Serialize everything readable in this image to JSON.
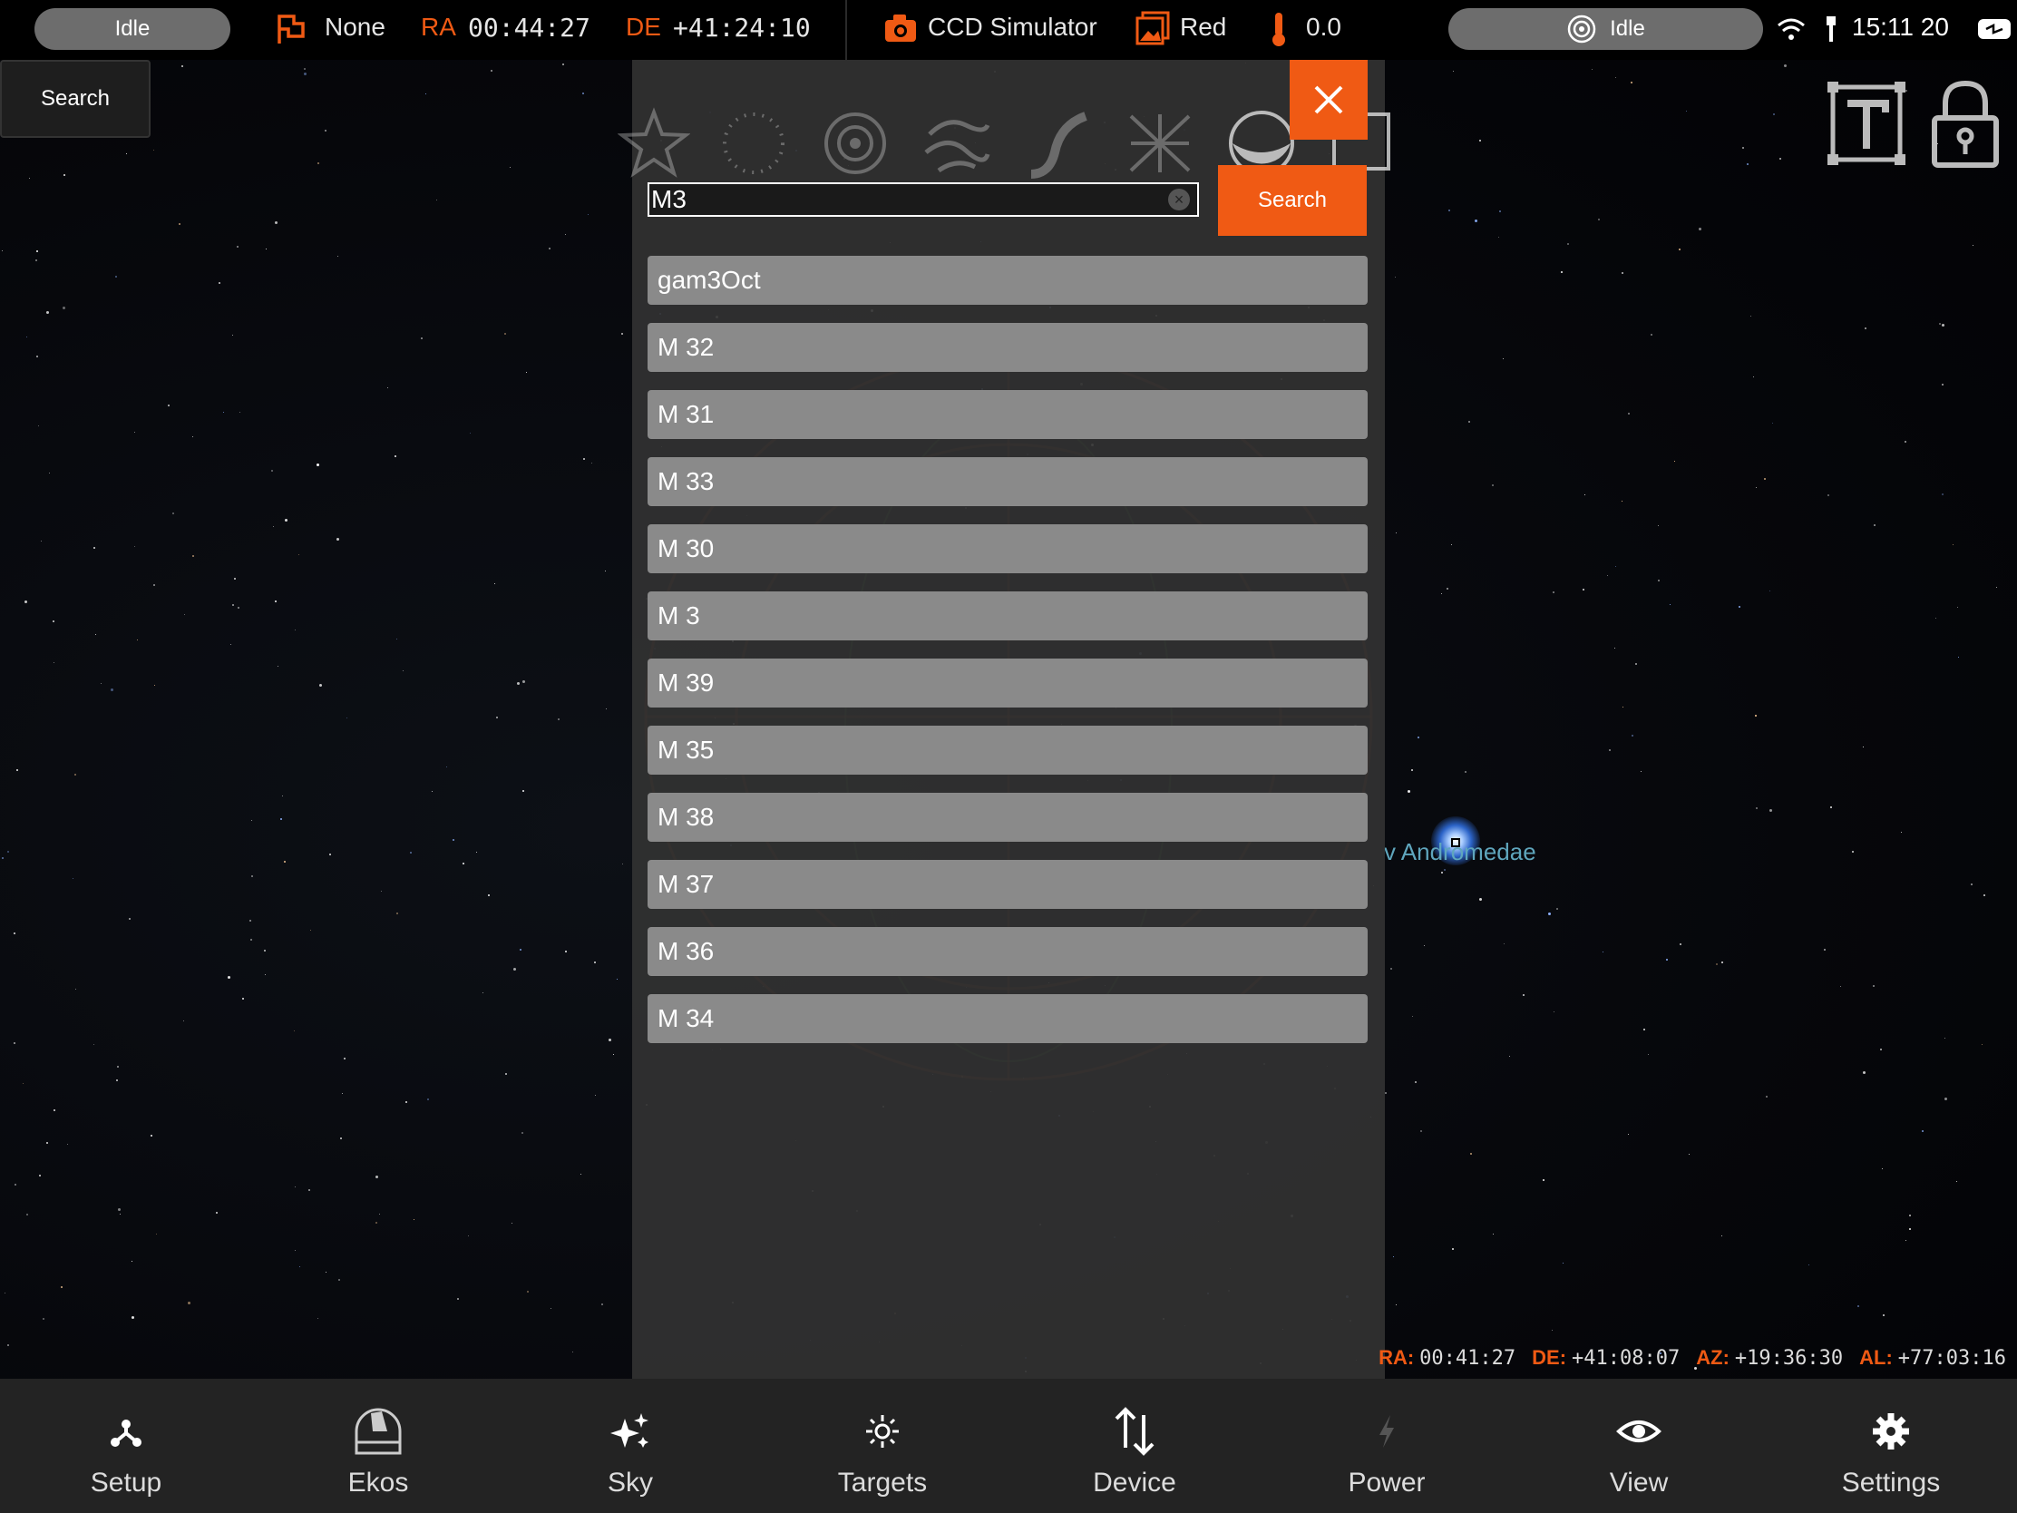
{
  "topbar": {
    "status_left": "Idle",
    "mount_status": "None",
    "ra_label": "RA",
    "ra_value": "00:44:27",
    "de_label": "DE",
    "de_value": "+41:24:10",
    "camera_name": "CCD Simulator",
    "filter_name": "Red",
    "temperature": "0.0",
    "status_right": "Idle",
    "time": "15:11 20"
  },
  "left_panel": {
    "search_label": "Search"
  },
  "dialog": {
    "search_value": "M3",
    "search_button": "Search",
    "results": [
      "gam3Oct",
      "M 32",
      "M 31",
      "M 33",
      "M 30",
      "M 3",
      "M 39",
      "M 35",
      "M 38",
      "M 37",
      "M 36",
      "M 34"
    ]
  },
  "sky": {
    "star_label": "v Andromedae"
  },
  "coords": {
    "ra_label": "RA:",
    "ra_value": "00:41:27",
    "de_label": "DE:",
    "de_value": "+41:08:07",
    "az_label": "AZ:",
    "az_value": "+19:36:30",
    "al_label": "AL:",
    "al_value": "+77:03:16"
  },
  "nav": {
    "items": [
      {
        "label": "Setup",
        "icon": "setup-icon"
      },
      {
        "label": "Ekos",
        "icon": "observatory-dome-icon"
      },
      {
        "label": "Sky",
        "icon": "sparkles-icon"
      },
      {
        "label": "Targets",
        "icon": "target-icon"
      },
      {
        "label": "Device",
        "icon": "arrows-updown-icon"
      },
      {
        "label": "Power",
        "icon": "lightning-icon"
      },
      {
        "label": "View",
        "icon": "eye-icon"
      },
      {
        "label": "Settings",
        "icon": "gear-icon"
      }
    ]
  },
  "colors": {
    "accent": "#f05a14",
    "nav_bg": "#232323",
    "result_bg": "#8a8a8a"
  }
}
